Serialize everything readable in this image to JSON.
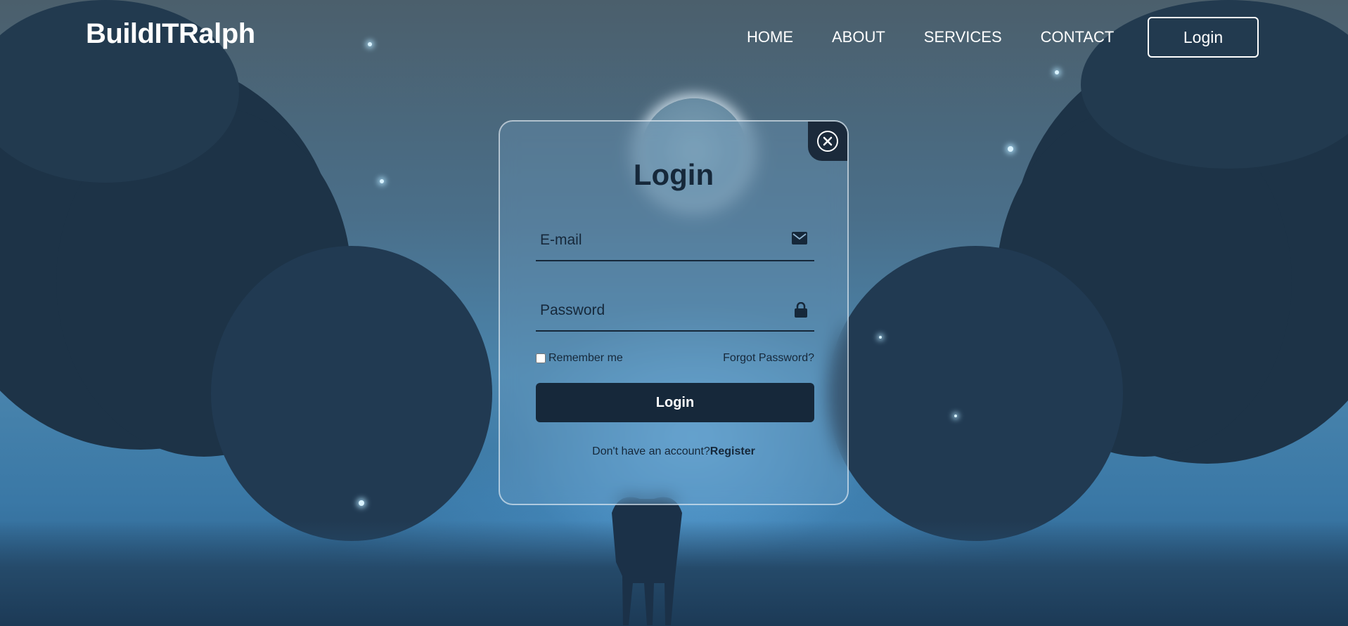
{
  "header": {
    "brand": "BuildITRalph",
    "nav": [
      "HOME",
      "ABOUT",
      "SERVICES",
      "CONTACT"
    ],
    "login_button": "Login"
  },
  "modal": {
    "title": "Login",
    "email_placeholder": "E-mail",
    "password_placeholder": "Password",
    "remember_label": "Remember me",
    "forgot_label": "Forgot Password?",
    "submit_label": "Login",
    "no_account_text": "Don't have an account?",
    "register_label": "Register"
  },
  "icons": {
    "close": "close-icon",
    "email": "envelope-icon",
    "password": "lock-icon"
  },
  "colors": {
    "primary_dark": "#16283a",
    "white": "#ffffff"
  }
}
